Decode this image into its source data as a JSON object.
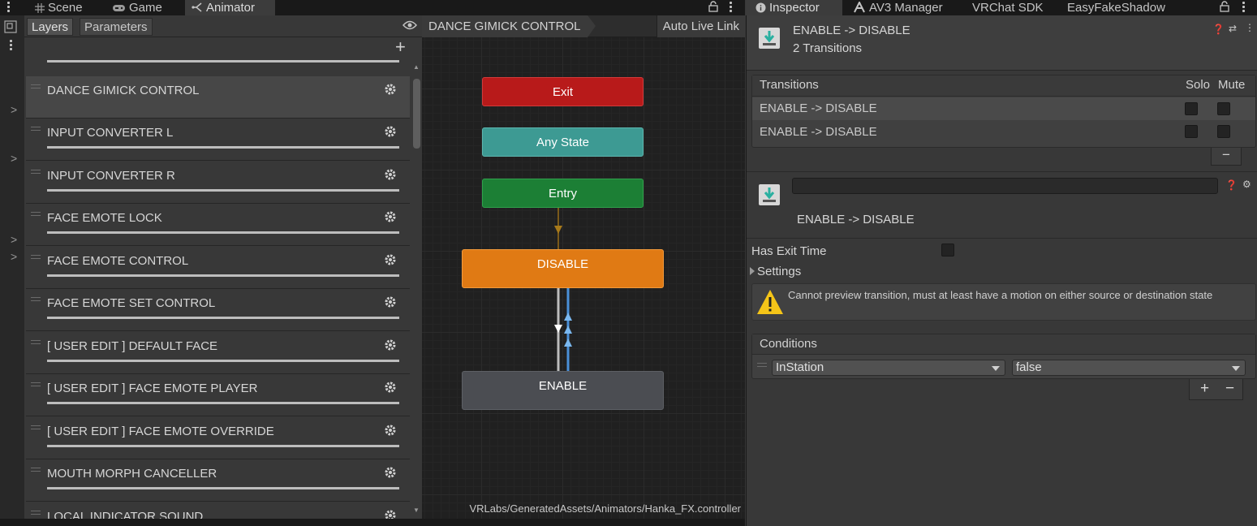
{
  "tabs_left": [
    {
      "label": "Scene",
      "icon": "grid-icon"
    },
    {
      "label": "Game",
      "icon": "gamepad-icon"
    },
    {
      "label": "Animator",
      "icon": "animator-icon"
    }
  ],
  "tabs_right": [
    {
      "label": "Inspector",
      "icon": "info-icon"
    },
    {
      "label": "AV3 Manager",
      "icon": "av3-icon"
    },
    {
      "label": "VRChat SDK"
    },
    {
      "label": "EasyFakeShadow"
    }
  ],
  "layers_panel": {
    "tab_layers": "Layers",
    "tab_parameters": "Parameters",
    "add_symbol": "+",
    "layers": [
      "DANCE GIMICK CONTROL",
      "INPUT CONVERTER L",
      "INPUT CONVERTER R",
      "FACE EMOTE LOCK",
      "FACE EMOTE CONTROL",
      "FACE EMOTE SET CONTROL",
      "[ USER EDIT ] DEFAULT FACE",
      "[ USER EDIT ] FACE EMOTE PLAYER",
      "[ USER EDIT ] FACE EMOTE OVERRIDE",
      "MOUTH MORPH CANCELLER",
      "LOCAL INDICATOR SOUND"
    ],
    "selected_index": 0
  },
  "graph": {
    "breadcrumb": "DANCE GIMICK CONTROL",
    "auto_live_link": "Auto Live Link",
    "nodes": {
      "exit": "Exit",
      "any_state": "Any State",
      "entry": "Entry",
      "disable": "DISABLE",
      "enable": "ENABLE"
    },
    "controller_path": "VRLabs/GeneratedAssets/Animators/Hanka_FX.controller",
    "colors": {
      "exit": "#b81a1a",
      "any_state": "#3d9a93",
      "entry": "#1c7f35",
      "disable": "#e07a14",
      "enable": "#4b4d52"
    }
  },
  "inspector": {
    "title": "ENABLE -> DISABLE",
    "subtitle": "2 Transitions",
    "transitions_header": "Transitions",
    "solo_header": "Solo",
    "mute_header": "Mute",
    "transitions": [
      {
        "name": "ENABLE -> DISABLE",
        "solo": false,
        "mute": false
      },
      {
        "name": "ENABLE -> DISABLE",
        "solo": false,
        "mute": false
      }
    ],
    "minus_symbol": "−",
    "transition_name_field": "",
    "transition_label": "ENABLE -> DISABLE",
    "has_exit_time_label": "Has Exit Time",
    "has_exit_time": false,
    "settings_label": "Settings",
    "warning_text": "Cannot preview transition, must at least have a motion on either source or destination state",
    "conditions_header": "Conditions",
    "condition_param": "InStation",
    "condition_value": "false",
    "plus_symbol": "+",
    "minus_symbol2": "−"
  }
}
